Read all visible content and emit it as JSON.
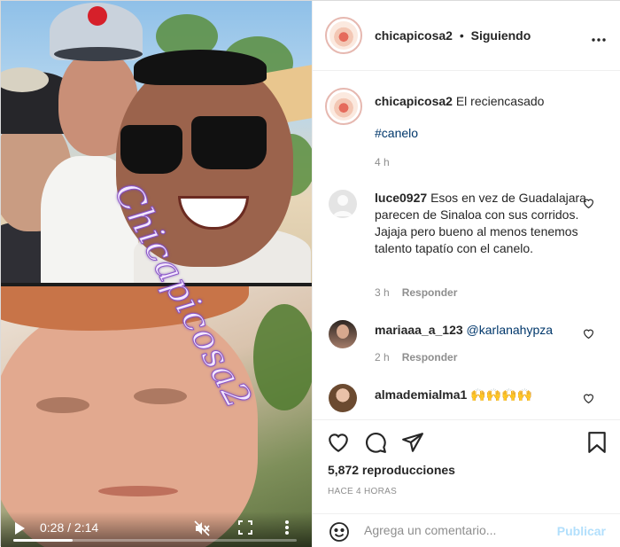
{
  "video": {
    "watermark": "Chicapicosa2",
    "time_current": "0:28",
    "time_total": "2:14",
    "progress_fraction": 0.21
  },
  "header": {
    "username": "chicapicosa2",
    "separator": "•",
    "follow_status": "Siguiendo",
    "more_icon": "more-horizontal-icon"
  },
  "caption": {
    "username": "chicapicosa2",
    "text": "El reciencasado",
    "hashtag": "#canelo",
    "time": "4 h"
  },
  "comments": [
    {
      "username": "luce0927",
      "text": "Esos en vez de Guadalajara parecen de Sinaloa con sus corridos. Jajaja pero bueno al menos tenemos talento tapatío con el canelo.",
      "time": "3 h",
      "reply": "Responder"
    },
    {
      "username": "mariaaa_a_123",
      "mention": "@karlanahypza",
      "time": "2 h",
      "reply": "Responder"
    },
    {
      "username": "almademialma1",
      "text": "🙌🙌🙌🙌"
    }
  ],
  "actions": {
    "views": "5,872 reproducciones",
    "posted": "HACE 4 HORAS"
  },
  "add_comment": {
    "placeholder": "Agrega un comentario...",
    "post_label": "Publicar"
  },
  "colors": {
    "link": "#00376b",
    "muted": "#8e8e8e",
    "post_disabled": "#b2dffc"
  }
}
